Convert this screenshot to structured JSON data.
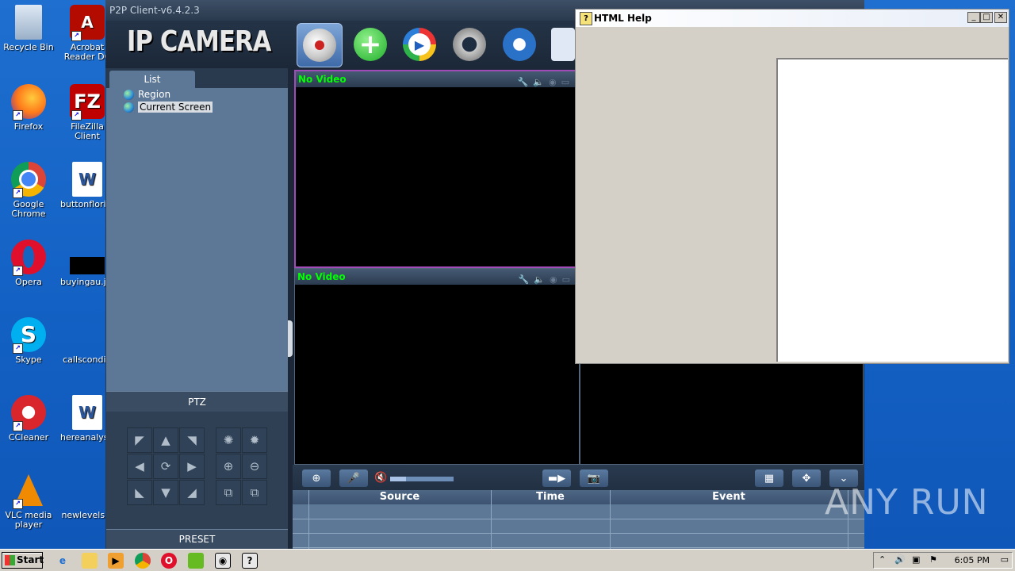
{
  "desktop": {
    "icons": [
      {
        "label": "Recycle Bin"
      },
      {
        "label": "Acrobat Reader DC"
      },
      {
        "label": "Firefox"
      },
      {
        "label": "FileZilla Client"
      },
      {
        "label": "Google Chrome"
      },
      {
        "label": "buttonflorida"
      },
      {
        "label": "Opera"
      },
      {
        "label": "buyingau.jpg"
      },
      {
        "label": "Skype"
      },
      {
        "label": "callsconditi"
      },
      {
        "label": "CCleaner"
      },
      {
        "label": "hereanalysis"
      },
      {
        "label": "VLC media player"
      },
      {
        "label": "newlevels.p"
      }
    ]
  },
  "app": {
    "title": "P2P Client-v6.4.2.3",
    "logo": "IP CAMERA",
    "toolbar": [
      {
        "icon": "camera-icon"
      },
      {
        "icon": "add-icon"
      },
      {
        "icon": "playback-icon"
      },
      {
        "icon": "ptz-icon"
      },
      {
        "icon": "settings-icon"
      },
      {
        "icon": "log-icon"
      }
    ],
    "list_tab": "List",
    "tree": [
      {
        "label": "Region"
      },
      {
        "label": "Current Screen"
      }
    ],
    "ptz_label": "PTZ",
    "preset_label": "PRESET",
    "video_cells": [
      {
        "status": "No Video"
      },
      {
        "status": "No Video"
      }
    ],
    "volume": 0.25,
    "event_columns": [
      "Source",
      "Time",
      "Event"
    ]
  },
  "help_window": {
    "title": "HTML Help"
  },
  "taskbar": {
    "start": "Start",
    "clock": "6:05 PM"
  },
  "watermark": "ANY RUN"
}
